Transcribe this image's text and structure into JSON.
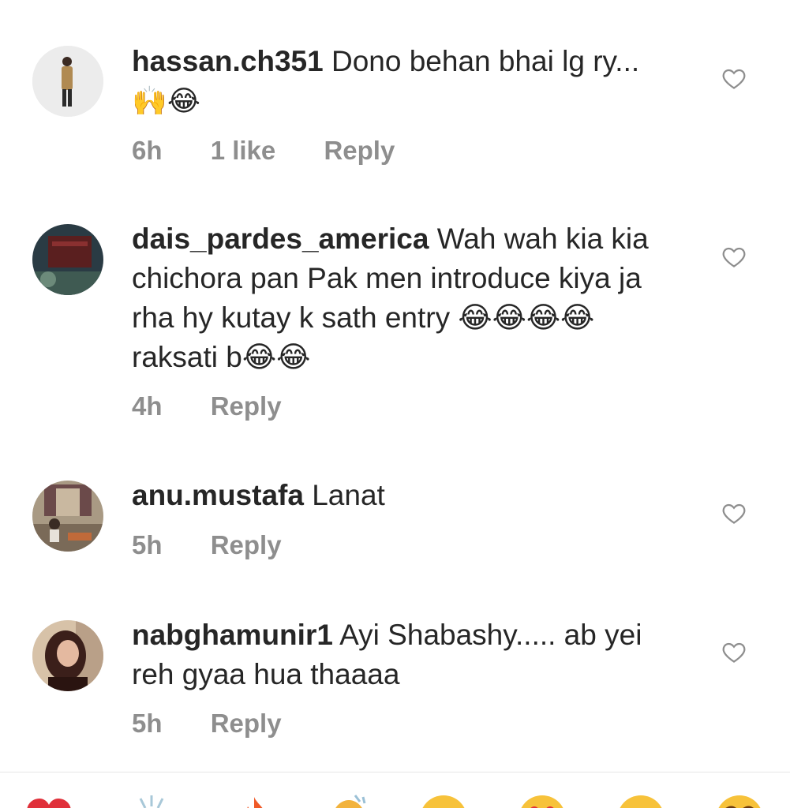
{
  "comments": [
    {
      "username": "hassan.ch351",
      "text": "Dono behan bhai lg ry...",
      "emoji": "🙌😂",
      "time": "6h",
      "likes": "1 like",
      "reply": "Reply",
      "avatar": "avatar-man-standing"
    },
    {
      "username": "dais_pardes_america",
      "text": "Wah wah kia kia chichora pan Pak men introduce kiya ja rha hy kutay k sath entry 😂😂😂😂 raksati b😂😂",
      "time": "4h",
      "reply": "Reply",
      "avatar": "avatar-dark-building"
    },
    {
      "username": "anu.mustafa",
      "text": "Lanat",
      "time": "5h",
      "reply": "Reply",
      "avatar": "avatar-room-scene"
    },
    {
      "username": "nabghamunir1",
      "text": "Ayi Shabashy..... ab yei reh gyaa hua thaaaa",
      "time": "5h",
      "reply": "Reply",
      "avatar": "avatar-woman-portrait"
    }
  ],
  "reactions": [
    "❤️",
    "🙌",
    "🔥",
    "👏",
    "😢",
    "😍",
    "😮",
    "😂"
  ],
  "colors": {
    "text": "#262626",
    "meta": "#8e8e8e",
    "divider": "#e6e6e6"
  }
}
